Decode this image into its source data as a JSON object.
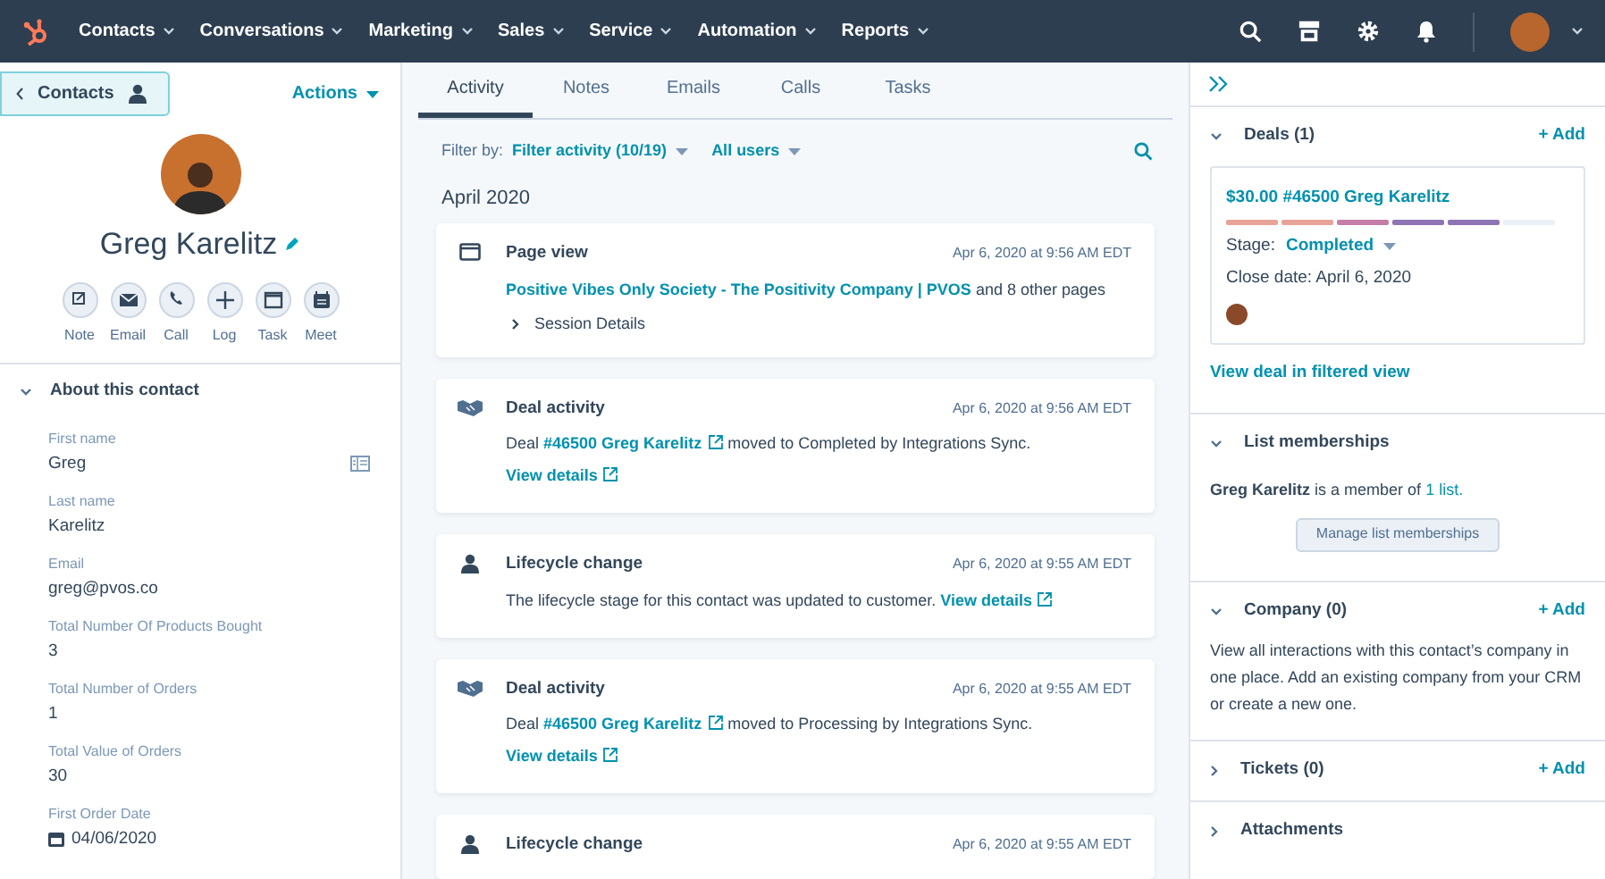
{
  "nav": {
    "items": [
      "Contacts",
      "Conversations",
      "Marketing",
      "Sales",
      "Service",
      "Automation",
      "Reports"
    ]
  },
  "left": {
    "back_label": "Contacts",
    "actions_label": "Actions",
    "name": "Greg Karelitz",
    "quick_actions": [
      {
        "kind": "note",
        "label": "Note"
      },
      {
        "kind": "email",
        "label": "Email"
      },
      {
        "kind": "call",
        "label": "Call"
      },
      {
        "kind": "log",
        "label": "Log"
      },
      {
        "kind": "task",
        "label": "Task"
      },
      {
        "kind": "meet",
        "label": "Meet"
      }
    ],
    "about": {
      "title": "About this contact",
      "expanded": true,
      "fields": [
        {
          "label": "First name",
          "value": "Greg"
        },
        {
          "label": "Last name",
          "value": "Karelitz"
        },
        {
          "label": "Email",
          "value": "greg@pvos.co"
        },
        {
          "label": "Total Number Of Products Bought",
          "value": "3"
        },
        {
          "label": "Total Number of Orders",
          "value": "1"
        },
        {
          "label": "Total Value of Orders",
          "value": "30"
        },
        {
          "label": "First Order Date",
          "value": "04/06/2020",
          "kind": "date"
        }
      ]
    }
  },
  "middle": {
    "tabs": [
      {
        "label": "Activity",
        "selected": true
      },
      {
        "label": "Notes",
        "selected": false
      },
      {
        "label": "Emails",
        "selected": false
      },
      {
        "label": "Calls",
        "selected": false
      },
      {
        "label": "Tasks",
        "selected": false
      }
    ],
    "filter_label": "Filter by:",
    "filters": [
      "Filter activity (10/19)",
      "All users"
    ],
    "month": "April 2020",
    "activities": [
      {
        "kind": "page_view",
        "title": "Page view",
        "time": "Apr 6, 2020 at 9:56 AM EDT",
        "parts": [
          {
            "text": "Positive Vibes Only Society - The Positivity Company | PVOS",
            "link": true
          },
          {
            "text": " and 8 other pages"
          }
        ],
        "details": "Session Details"
      },
      {
        "kind": "deal",
        "title": "Deal activity",
        "time": "Apr 6, 2020 at 9:56 AM EDT",
        "parts": [
          {
            "text": "Deal "
          },
          {
            "text": "#46500 Greg Karelitz",
            "link": true,
            "external": true
          },
          {
            "text": " moved to Completed by Integrations Sync. "
          },
          {
            "text": "View details",
            "link": true,
            "external": true
          }
        ]
      },
      {
        "kind": "lifecycle",
        "title": "Lifecycle change",
        "time": "Apr 6, 2020 at 9:55 AM EDT",
        "parts": [
          {
            "text": "The lifecycle stage for this contact was updated to customer. "
          },
          {
            "text": "View details",
            "link": true,
            "external": true
          }
        ]
      },
      {
        "kind": "deal",
        "title": "Deal activity",
        "time": "Apr 6, 2020 at 9:55 AM EDT",
        "parts": [
          {
            "text": "Deal "
          },
          {
            "text": "#46500 Greg Karelitz",
            "link": true,
            "external": true
          },
          {
            "text": " moved to Processing by Integrations Sync. "
          },
          {
            "text": "View details",
            "link": true,
            "external": true
          }
        ]
      },
      {
        "kind": "lifecycle",
        "title": "Lifecycle change",
        "time": "Apr 6, 2020 at 9:55 AM EDT"
      }
    ]
  },
  "right": {
    "sections": [
      {
        "kind": "deals",
        "title": "Deals (1)",
        "expanded": true,
        "add": "+ Add",
        "deal": {
          "title": "$30.00 #46500 Greg Karelitz",
          "stages": [
            {
              "color": "#e8a398"
            },
            {
              "color": "#e8a398"
            },
            {
              "color": "#c47ea8"
            },
            {
              "color": "#8e73b5"
            },
            {
              "color": "#8e73b5"
            },
            {
              "color": "#eaf0f6"
            }
          ],
          "stage_label": "Stage:",
          "stage": "Completed",
          "close_date": "Close date: April 6, 2020"
        },
        "link": "View deal in filtered view"
      },
      {
        "kind": "lists",
        "title": "List memberships",
        "expanded": true,
        "parts": [
          {
            "text": "Greg Karelitz",
            "bold": true
          },
          {
            "text": " is a member of "
          },
          {
            "text": "1 list.",
            "link": true
          }
        ],
        "button": "Manage list memberships"
      },
      {
        "kind": "text",
        "title": "Company (0)",
        "expanded": true,
        "add": "+ Add",
        "text": "View all interactions with this contact’s company in one place. Add an existing company from your CRM or create a new one."
      },
      {
        "title": "Tickets (0)",
        "expanded": false,
        "add": "+ Add"
      },
      {
        "title": "Attachments",
        "expanded": false
      }
    ]
  }
}
